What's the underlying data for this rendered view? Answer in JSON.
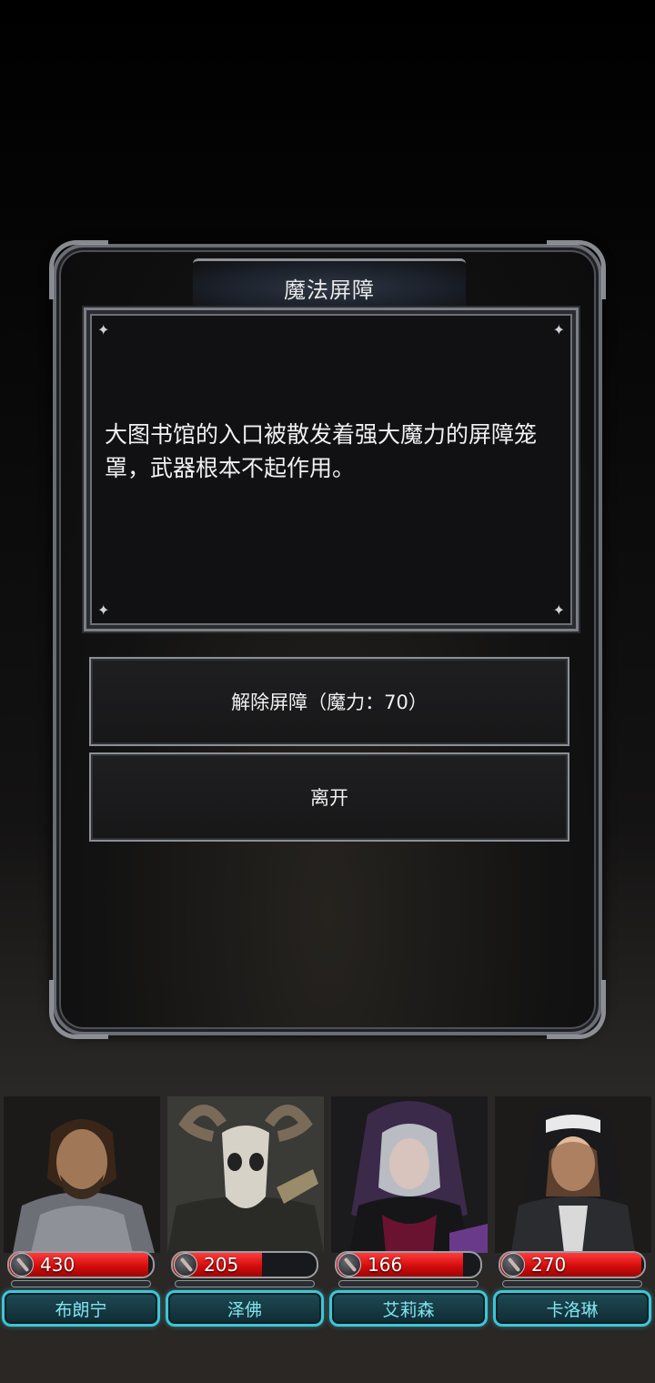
{
  "dialog": {
    "title": "魔法屏障",
    "message": "大图书馆的入口被散发着强大魔力的屏障笼罩，武器根本不起作用。",
    "choices": [
      {
        "label": "解除屏障（魔力：70）"
      },
      {
        "label": "离开"
      }
    ]
  },
  "party": [
    {
      "name": "布朗宁",
      "hp": "430",
      "hp_fraction": 0.97
    },
    {
      "name": "泽佛",
      "hp": "205",
      "hp_fraction": 0.62
    },
    {
      "name": "艾莉森",
      "hp": "166",
      "hp_fraction": 0.88
    },
    {
      "name": "卡洛琳",
      "hp": "270",
      "hp_fraction": 0.98
    }
  ],
  "colors": {
    "hp_red": "#d50d0d",
    "name_plate_cyan": "#3cc6d6",
    "frame_silver": "#8c8f95"
  },
  "icons": {
    "hp_icon": "sword-emblem-icon",
    "panel_ornament": "sparkle-icon"
  }
}
